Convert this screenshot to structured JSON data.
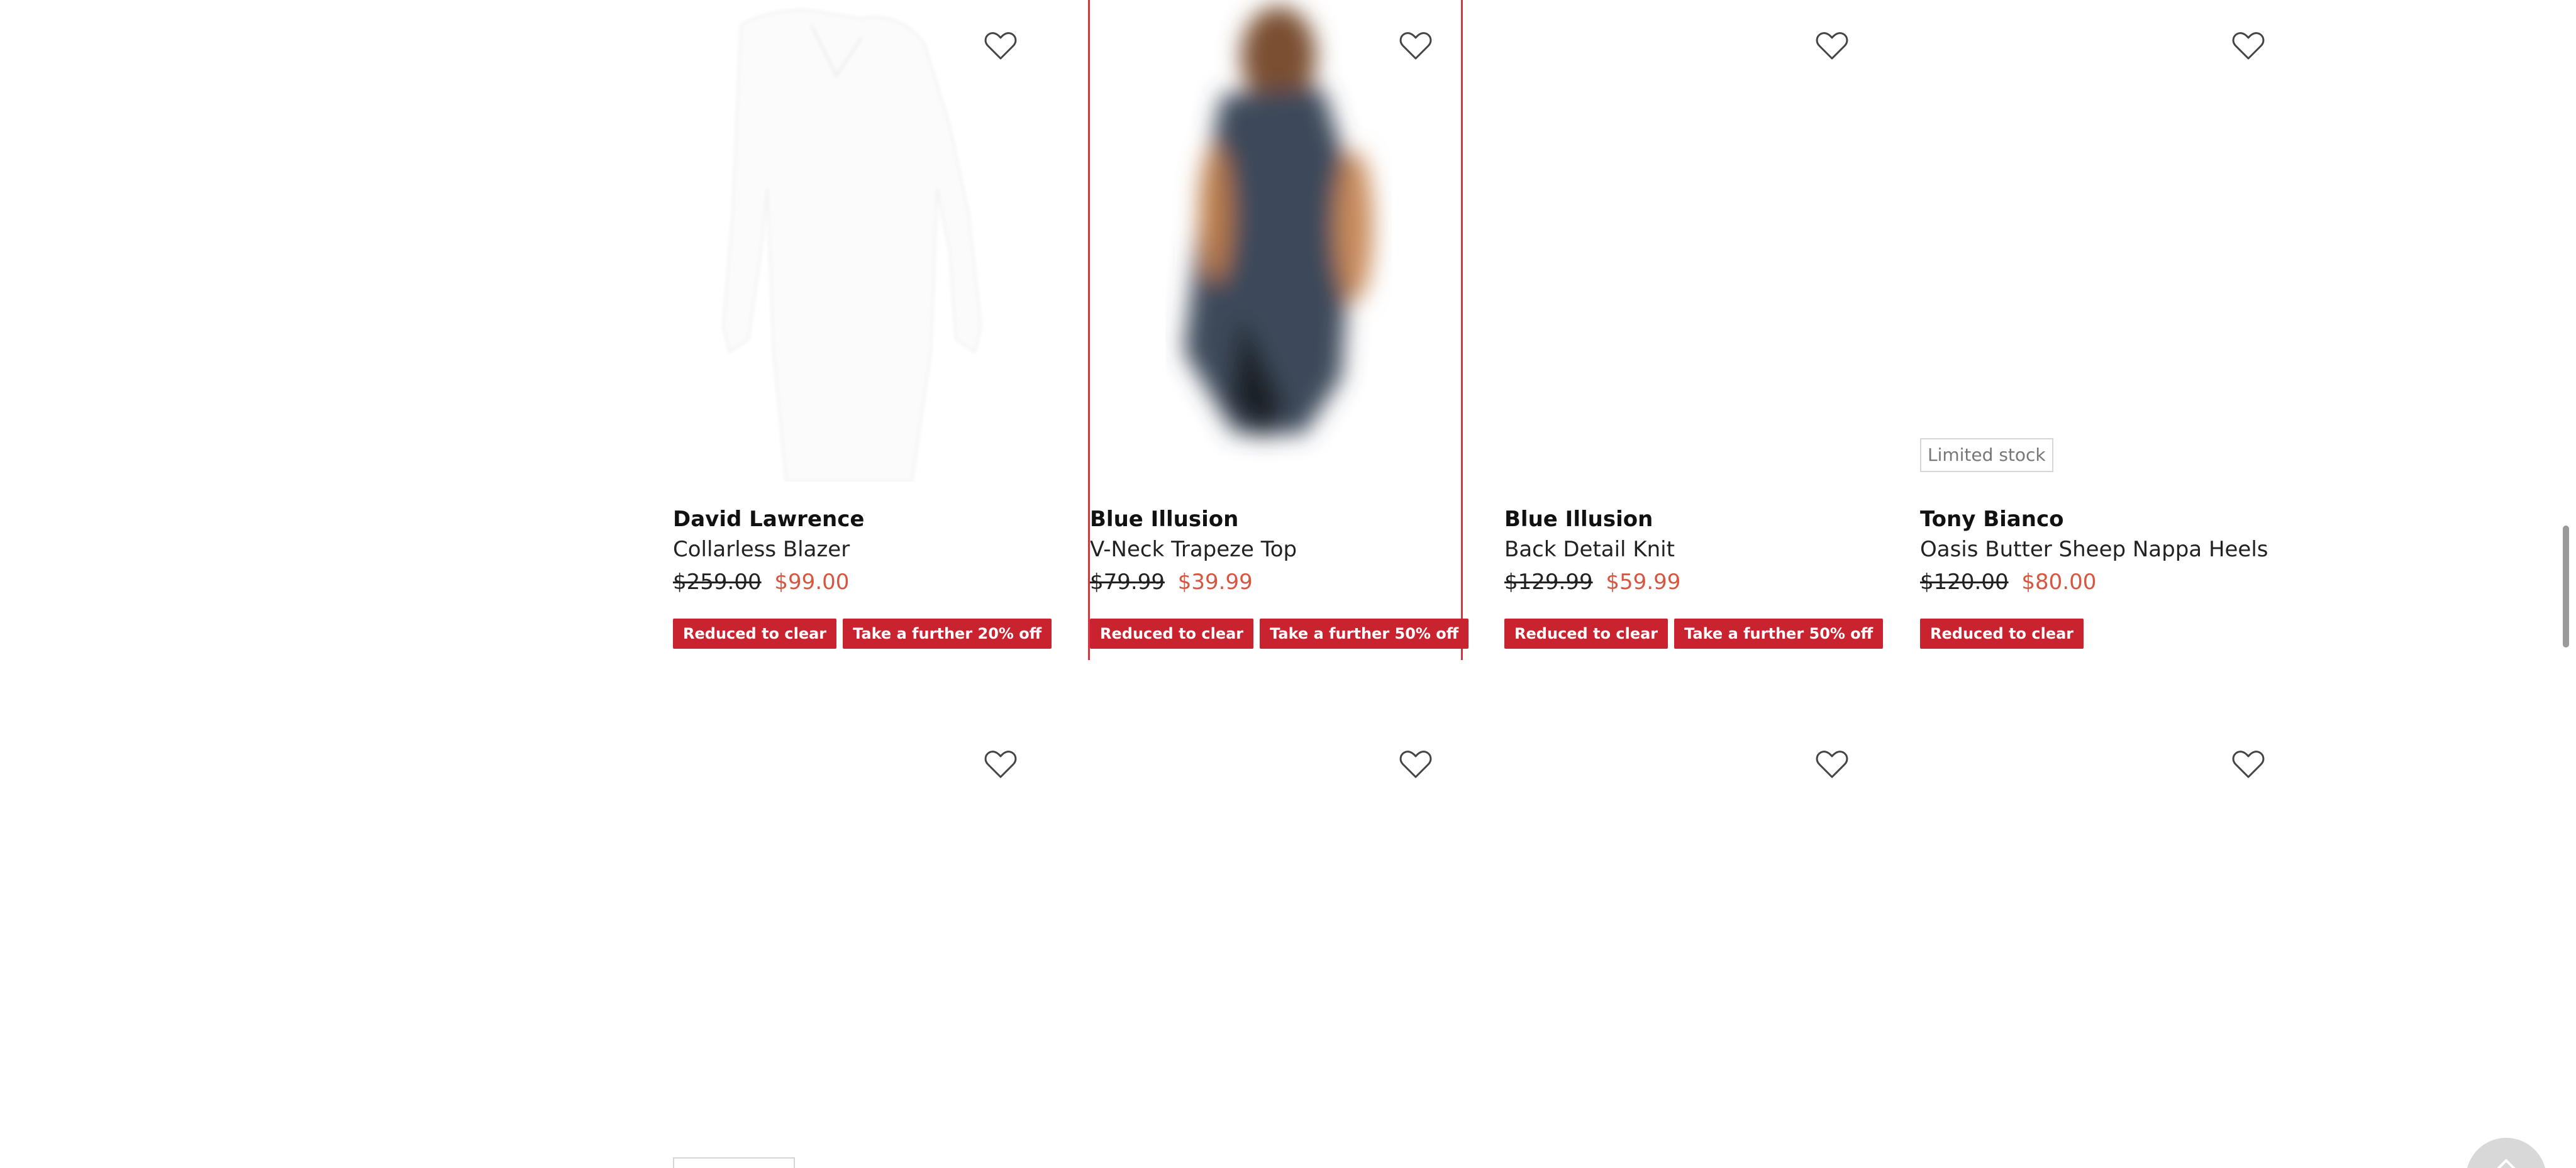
{
  "products": [
    {
      "brand": "David Lawrence",
      "name": "Collarless Blazer",
      "price_old": "$259.00",
      "price_new": "$99.00",
      "badges": [
        "Reduced to clear",
        "Take a further 20% off"
      ],
      "icon": "heart-icon"
    },
    {
      "brand": "Blue Illusion",
      "name": "V-Neck Trapeze Top",
      "price_old": "$79.99",
      "price_new": "$39.99",
      "badges": [
        "Reduced to clear",
        "Take a further 50% off"
      ],
      "icon": "heart-icon"
    },
    {
      "brand": "Blue Illusion",
      "name": "Back Detail Knit",
      "price_old": "$129.99",
      "price_new": "$59.99",
      "badges": [
        "Reduced to clear",
        "Take a further 50% off"
      ],
      "icon": "heart-icon"
    },
    {
      "brand": "Tony Bianco",
      "name": "Oasis Butter Sheep Nappa Heels",
      "price_old": "$120.00",
      "price_new": "$80.00",
      "stock_tag": "Limited stock",
      "badges": [
        "Reduced to clear"
      ],
      "icon": "heart-icon"
    }
  ],
  "colors": {
    "badge": "#c8232e",
    "sale_price": "#d8553f",
    "selection_border": "#d8353f"
  }
}
